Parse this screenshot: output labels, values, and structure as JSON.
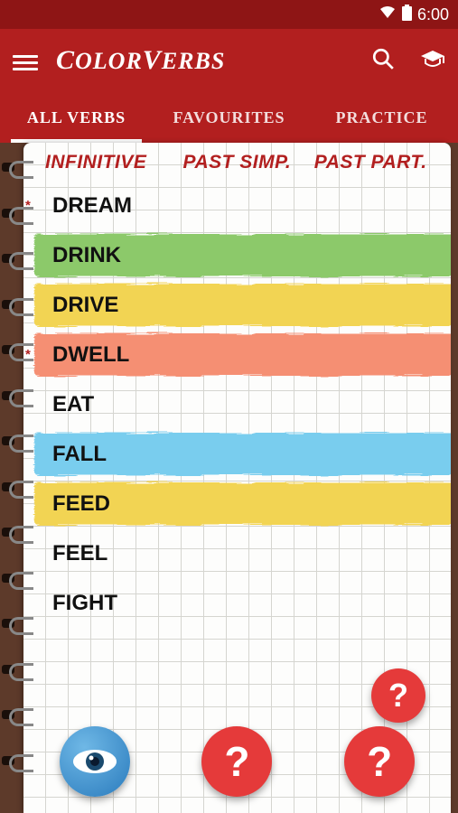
{
  "status": {
    "time": "6:00"
  },
  "header": {
    "title": "ColorVerbs"
  },
  "tabs": [
    {
      "label": "ALL VERBS",
      "active": true
    },
    {
      "label": "FAVOURITES",
      "active": false
    },
    {
      "label": "PRACTICE",
      "active": false
    }
  ],
  "columns": {
    "infinitive": "INFINITIVE",
    "past_simp": "PAST SIMP.",
    "past_part": "PAST PART."
  },
  "verbs": [
    {
      "word": "DREAM",
      "highlight": null,
      "starred": true
    },
    {
      "word": "DRINK",
      "highlight": "green",
      "starred": false
    },
    {
      "word": "DRIVE",
      "highlight": "yellow",
      "starred": false
    },
    {
      "word": "DWELL",
      "highlight": "salmon",
      "starred": true
    },
    {
      "word": "EAT",
      "highlight": null,
      "starred": false
    },
    {
      "word": "FALL",
      "highlight": "blue",
      "starred": false
    },
    {
      "word": "FEED",
      "highlight": "yellow",
      "starred": false
    },
    {
      "word": "FEEL",
      "highlight": null,
      "starred": false
    },
    {
      "word": "FIGHT",
      "highlight": null,
      "starred": false
    }
  ],
  "buttons": {
    "help": "?"
  }
}
